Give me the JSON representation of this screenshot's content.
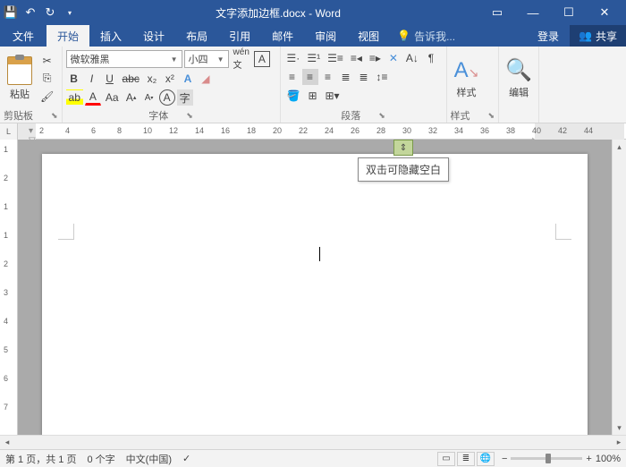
{
  "titlebar": {
    "doc_title": "文字添加边框.docx - Word"
  },
  "tabs": {
    "file": "文件",
    "home": "开始",
    "insert": "插入",
    "design": "设计",
    "layout": "布局",
    "references": "引用",
    "mailings": "邮件",
    "review": "审阅",
    "view": "视图",
    "tellme": "告诉我...",
    "login": "登录",
    "share": "共享"
  },
  "ribbon": {
    "clipboard": {
      "paste": "粘贴",
      "label": "剪贴板"
    },
    "font": {
      "name": "微软雅黑",
      "size": "小四",
      "label": "字体"
    },
    "paragraph": {
      "label": "段落"
    },
    "styles": {
      "label": "样式",
      "btn": "样式"
    },
    "editing": {
      "label": "编辑",
      "btn": "编辑"
    }
  },
  "ruler": {
    "corner": "L",
    "nums": [
      2,
      4,
      6,
      8,
      10,
      12,
      14,
      16,
      18,
      20,
      22,
      24,
      26,
      28,
      30,
      32,
      34,
      36,
      38,
      40,
      42,
      44
    ]
  },
  "vruler": {
    "nums": [
      1,
      2,
      1,
      1,
      2,
      3,
      4,
      5,
      6,
      7
    ]
  },
  "tooltip": {
    "text": "双击可隐藏空白"
  },
  "status": {
    "page": "第 1 页，共 1 页",
    "words": "0 个字",
    "lang": "中文(中国)",
    "zoom_pct": "100%"
  }
}
